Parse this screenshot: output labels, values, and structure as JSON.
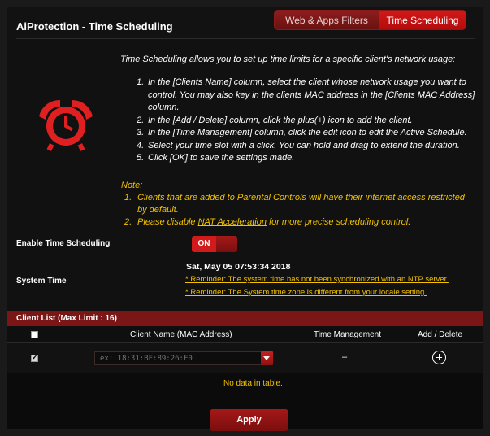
{
  "page": {
    "title": "AiProtection - Time Scheduling"
  },
  "tabs": [
    {
      "label": "Web & Apps Filters",
      "active": false
    },
    {
      "label": "Time Scheduling",
      "active": true
    }
  ],
  "description": "Time Scheduling allows you to set up time limits for a specific client's network usage:",
  "steps": [
    {
      "num": "1.",
      "text": "In the [Clients Name] column, select the client whose network usage you want to control. You may also key in the clients MAC address in the [Clients MAC Address] column."
    },
    {
      "num": "2.",
      "text": "In the [Add / Delete] column, click the plus(+) icon to add the client."
    },
    {
      "num": "3.",
      "text": "In the [Time Management] column, click the edit icon to edit the Active Schedule."
    },
    {
      "num": "4.",
      "text": "Select your time slot with a click. You can hold and drag to extend the duration."
    },
    {
      "num": "5.",
      "text": "Click [OK] to save the settings made."
    }
  ],
  "note": {
    "heading": "Note:",
    "item1_num": "1.",
    "item1": "Clients that are added to Parental Controls will have their internet access restricted by default.",
    "item2_num": "2.",
    "item2_prefix": "Please disable ",
    "item2_link": "NAT Acceleration",
    "item2_suffix": " for more precise scheduling control."
  },
  "settings": {
    "enable_label": "Enable Time Scheduling",
    "toggle_state": "ON",
    "system_time_label": "System Time",
    "system_time_value": "Sat, May 05 07:53:34 2018",
    "reminder_ntp": "* Reminder: The system time has not been synchronized with an NTP server.",
    "reminder_zone": "* Reminder: The System time zone is different from your locale setting."
  },
  "client_list": {
    "header": "Client List (Max Limit : 16)",
    "columns": [
      "Client Name (MAC Address)",
      "Time Management",
      "Add / Delete"
    ],
    "input_placeholder": "ex: 18:31:BF:89:26:E0",
    "time_management_value": "–",
    "empty_text": "No data in table."
  },
  "actions": {
    "apply_label": "Apply"
  },
  "colors": {
    "accent_red": "#d11a1a",
    "dark_red": "#7a1616",
    "note_yellow": "#f2c200",
    "background": "#111111"
  }
}
